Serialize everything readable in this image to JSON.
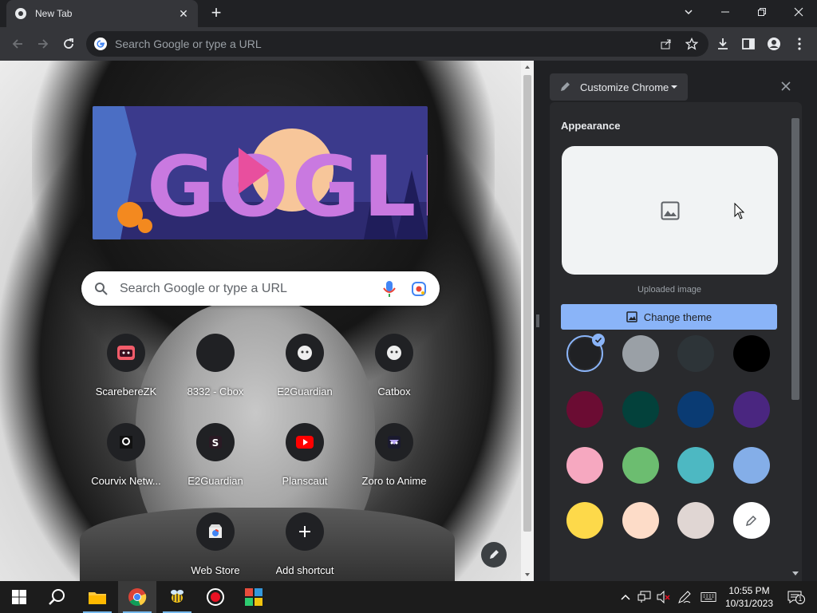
{
  "browser": {
    "tab_title": "New Tab",
    "omnibox_placeholder": "Search Google or type a URL"
  },
  "ntp": {
    "search_placeholder": "Search Google or type a URL",
    "doodle_letters": "GOGLE",
    "shortcuts": [
      {
        "label": "ScarebereZK",
        "icon": "scarebere-icon"
      },
      {
        "label": "8332 - Cbox",
        "icon": "blank-icon"
      },
      {
        "label": "E2Guardian",
        "icon": "e2guardian-icon"
      },
      {
        "label": "Catbox",
        "icon": "catbox-icon"
      },
      {
        "label": "Courvix Netw...",
        "icon": "courvix-icon"
      },
      {
        "label": "E2Guardian",
        "icon": "s-letter-icon"
      },
      {
        "label": "Planscaut",
        "icon": "youtube-icon"
      },
      {
        "label": "Zoro to Anime",
        "icon": "zoro-icon"
      },
      {
        "label": "Web Store",
        "icon": "web-store-icon"
      },
      {
        "label": "Add shortcut",
        "icon": "plus-icon"
      }
    ]
  },
  "panel": {
    "title": "Customize Chrome",
    "section_title": "Appearance",
    "uploaded_label": "Uploaded image",
    "change_theme_label": "Change theme",
    "swatches": [
      {
        "color": "#202124",
        "selected": true
      },
      {
        "color": "#9aa0a6",
        "selected": false
      },
      {
        "color": "#2d3438",
        "selected": false
      },
      {
        "color": "#000000",
        "selected": false
      },
      {
        "color": "#6b0c33",
        "selected": false
      },
      {
        "color": "#03413b",
        "selected": false
      },
      {
        "color": "#0a3b73",
        "selected": false
      },
      {
        "color": "#4a2680",
        "selected": false
      },
      {
        "color": "#f6a8c0",
        "selected": false
      },
      {
        "color": "#6cbd70",
        "selected": false
      },
      {
        "color": "#4db8c2",
        "selected": false
      },
      {
        "color": "#84aee8",
        "selected": false
      },
      {
        "color": "#fdd94a",
        "selected": false
      },
      {
        "color": "#fddcc8",
        "selected": false
      },
      {
        "color": "#e0d6d3",
        "selected": false
      },
      {
        "color": "#ffffff",
        "custom": true
      }
    ]
  },
  "taskbar": {
    "time": "10:55 PM",
    "date": "10/31/2023",
    "notification_count": "1"
  }
}
